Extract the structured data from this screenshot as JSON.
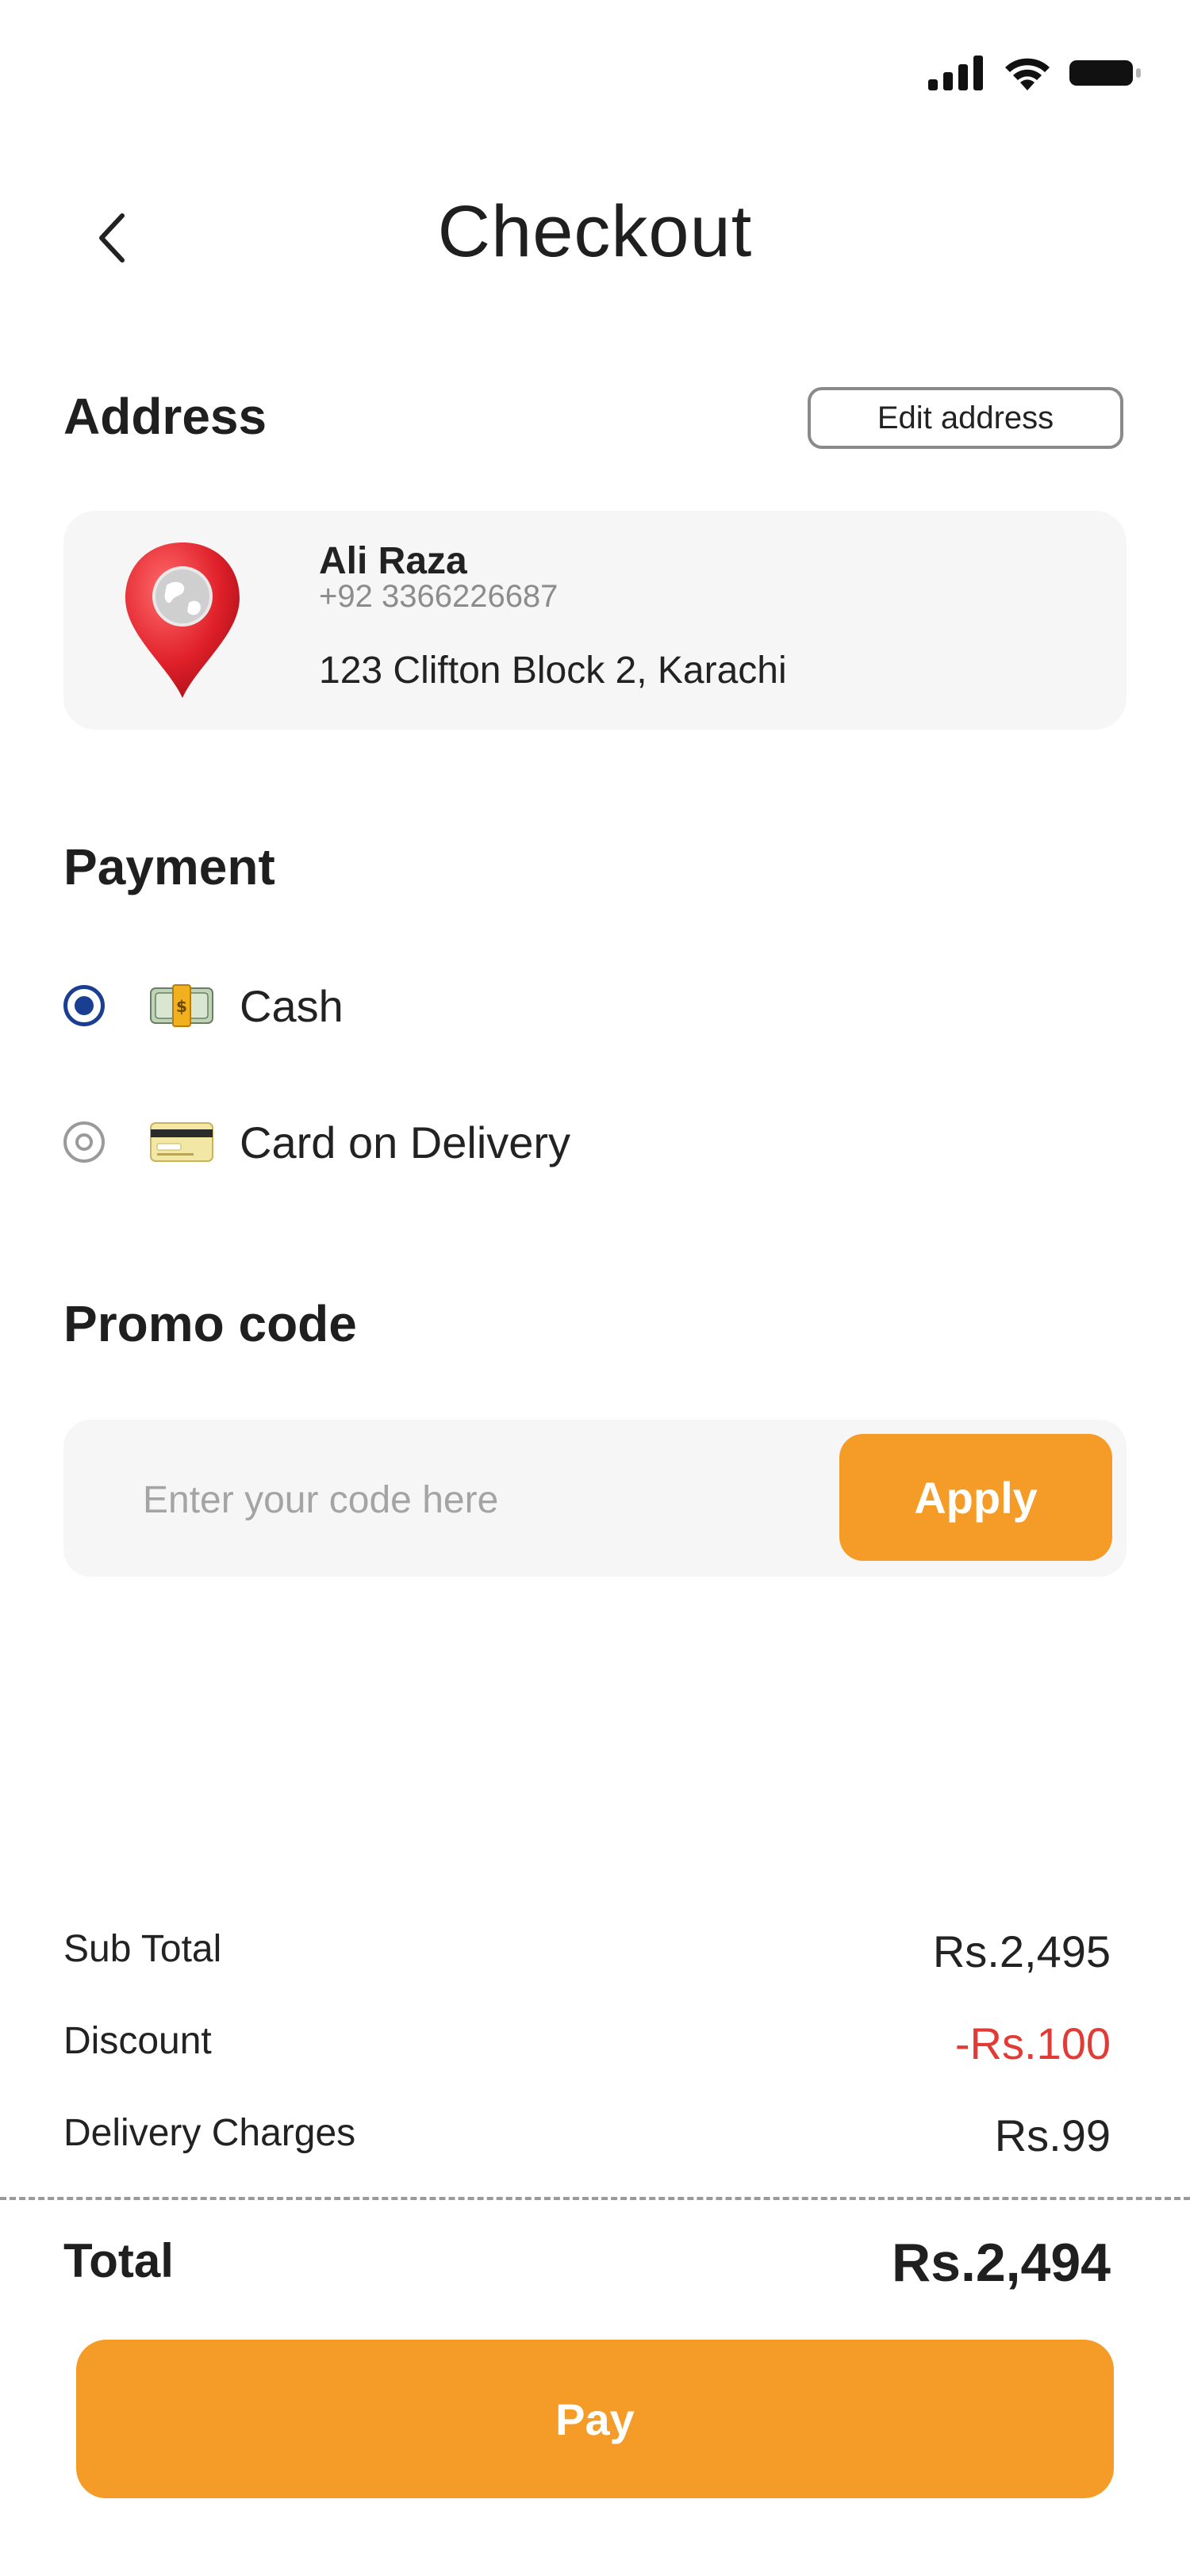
{
  "status_bar": {
    "signal_icon": "signal-bars-icon",
    "wifi_icon": "wifi-icon",
    "battery_icon": "battery-icon"
  },
  "header": {
    "title": "Checkout",
    "back_icon": "chevron-left-icon"
  },
  "address": {
    "heading": "Address",
    "edit_label": "Edit address",
    "name": "Ali Raza",
    "phone": "+92 3366226687",
    "line": "123 Clifton Block 2, Karachi",
    "icon": "map-pin-icon"
  },
  "payment": {
    "heading": "Payment",
    "options": [
      {
        "label": "Cash",
        "icon": "cash-icon",
        "selected": true
      },
      {
        "label": "Card on Delivery",
        "icon": "credit-card-icon",
        "selected": false
      }
    ]
  },
  "promo": {
    "heading": "Promo code",
    "placeholder": "Enter your code here",
    "value": "",
    "apply_label": "Apply"
  },
  "summary": {
    "sub_total_label": "Sub Total",
    "sub_total_value": "Rs.2,495",
    "discount_label": "Discount",
    "discount_value": "-Rs.100",
    "delivery_label": "Delivery Charges",
    "delivery_value": "Rs.99",
    "total_label": "Total",
    "total_value": "Rs.2,494"
  },
  "pay_button": {
    "label": "Pay"
  },
  "colors": {
    "accent": "#f59c28",
    "radio_selected": "#1a3e92",
    "discount": "#e23b36",
    "card_bg": "#f6f6f6"
  }
}
